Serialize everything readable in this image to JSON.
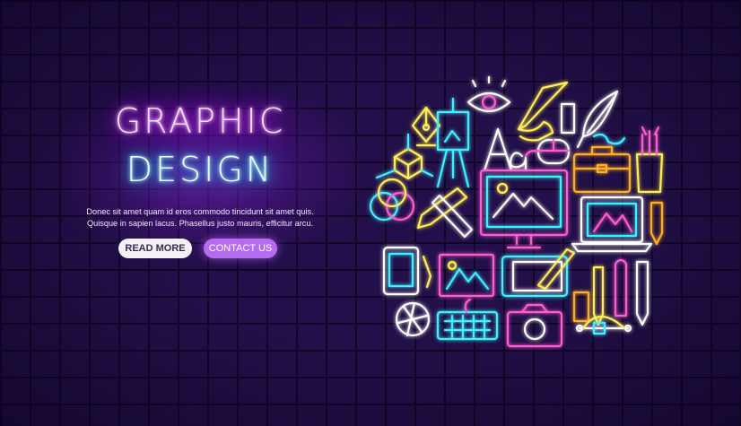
{
  "hero": {
    "title_line1": "GRAPHIC",
    "title_line2": "DESIGN",
    "body_line1": "Donec sit amet quam id eros commodo tincidunt sit amet quis.",
    "body_line2": "Quisque in sapien lacus. Phasellus justo mauris, efficitur arcu."
  },
  "buttons": {
    "read_more": "READ MORE",
    "contact_us": "CONTACT US"
  },
  "icons": [
    "eye-icon",
    "pen-nib-icon",
    "easel-icon",
    "pencil-hand-icon",
    "ruler-icon",
    "feather-icon",
    "cube-icon",
    "font-icon",
    "mouse-icon",
    "briefcase-icon",
    "pencil-cup-icon",
    "color-circles-icon",
    "monitor-icon",
    "laptop-icon",
    "pencil-ruler-icon",
    "dropper-icon",
    "tablet-icon",
    "picture-icon",
    "graphics-tablet-icon",
    "marker-icon",
    "brush-icon",
    "aperture-icon",
    "keyboard-icon",
    "camera-icon",
    "bezier-icon"
  ],
  "colors": {
    "background": "#23104a",
    "title_pink": "#e040ff",
    "title_cyan": "#00e5ff",
    "contact_button": "#b66cf0",
    "read_button": "#f3f1f4"
  }
}
